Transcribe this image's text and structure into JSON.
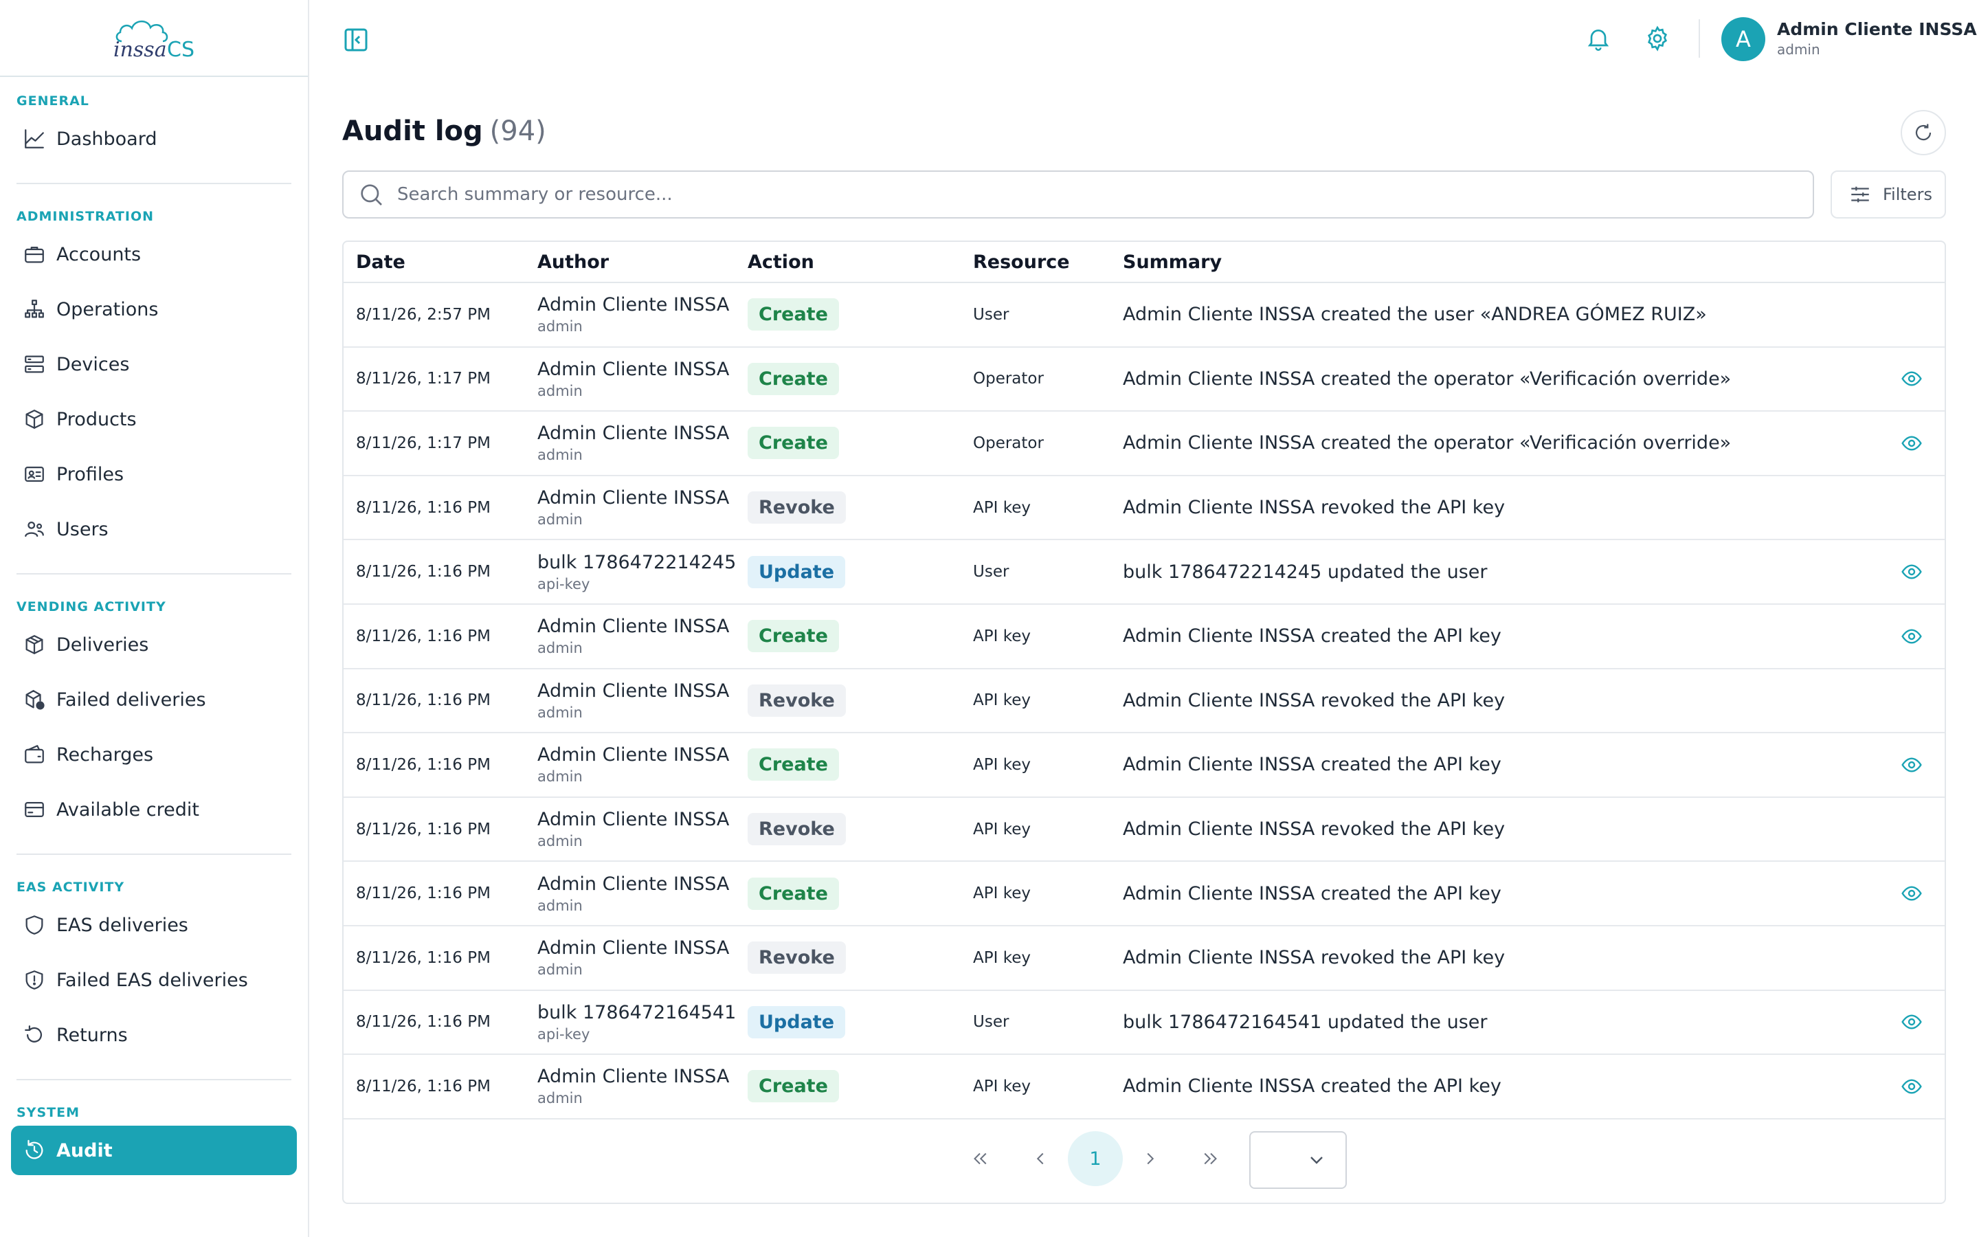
{
  "brand": {
    "name": "Inssa CS",
    "logo_text_left": "inssa",
    "logo_text_right": "CS",
    "accent": "#1ba3b4"
  },
  "sidebar": {
    "sections": [
      {
        "label": "GENERAL",
        "items": [
          {
            "label": "Dashboard",
            "icon": "chart-line-icon"
          }
        ]
      },
      {
        "label": "ADMINISTRATION",
        "items": [
          {
            "label": "Accounts",
            "icon": "briefcase-icon"
          },
          {
            "label": "Operations",
            "icon": "sitemap-icon"
          },
          {
            "label": "Devices",
            "icon": "server-icon"
          },
          {
            "label": "Products",
            "icon": "box-icon"
          },
          {
            "label": "Profiles",
            "icon": "id-card-icon"
          },
          {
            "label": "Users",
            "icon": "users-icon"
          }
        ]
      },
      {
        "label": "VENDING ACTIVITY",
        "items": [
          {
            "label": "Deliveries",
            "icon": "package-icon"
          },
          {
            "label": "Failed deliveries",
            "icon": "package-alert-icon"
          },
          {
            "label": "Recharges",
            "icon": "wallet-icon"
          },
          {
            "label": "Available credit",
            "icon": "credit-card-icon"
          }
        ]
      },
      {
        "label": "EAS ACTIVITY",
        "items": [
          {
            "label": "EAS deliveries",
            "icon": "shield-icon"
          },
          {
            "label": "Failed EAS deliveries",
            "icon": "shield-alert-icon"
          },
          {
            "label": "Returns",
            "icon": "return-icon"
          }
        ]
      },
      {
        "label": "SYSTEM",
        "items": [
          {
            "label": "Audit",
            "icon": "history-icon",
            "active": true
          }
        ]
      }
    ]
  },
  "topbar": {
    "user": {
      "initial": "A",
      "name": "Admin Cliente INSSA",
      "role": "admin"
    }
  },
  "main": {
    "title": "Audit log",
    "count": "(94)",
    "search_placeholder": "Search summary or resource...",
    "filters_label": "Filters",
    "columns": {
      "date": "Date",
      "author": "Author",
      "action": "Action",
      "resource": "Resource",
      "summary": "Summary"
    },
    "rows": [
      {
        "date": "8/11/26, 2:57 PM",
        "author": "Admin Cliente INSSA",
        "role": "admin",
        "action": "Create",
        "resource": "User",
        "summary": "Admin Cliente INSSA created the user «ANDREA GÓMEZ RUIZ»",
        "view": false
      },
      {
        "date": "8/11/26, 1:17 PM",
        "author": "Admin Cliente INSSA",
        "role": "admin",
        "action": "Create",
        "resource": "Operator",
        "summary": "Admin Cliente INSSA created the operator «Verificación override»",
        "view": true
      },
      {
        "date": "8/11/26, 1:17 PM",
        "author": "Admin Cliente INSSA",
        "role": "admin",
        "action": "Create",
        "resource": "Operator",
        "summary": "Admin Cliente INSSA created the operator «Verificación override»",
        "view": true
      },
      {
        "date": "8/11/26, 1:16 PM",
        "author": "Admin Cliente INSSA",
        "role": "admin",
        "action": "Revoke",
        "resource": "API key",
        "summary": "Admin Cliente INSSA revoked the API key",
        "view": false
      },
      {
        "date": "8/11/26, 1:16 PM",
        "author": "bulk 1786472214245",
        "role": "api-key",
        "action": "Update",
        "resource": "User",
        "summary": "bulk 1786472214245 updated the user",
        "view": true
      },
      {
        "date": "8/11/26, 1:16 PM",
        "author": "Admin Cliente INSSA",
        "role": "admin",
        "action": "Create",
        "resource": "API key",
        "summary": "Admin Cliente INSSA created the API key",
        "view": true
      },
      {
        "date": "8/11/26, 1:16 PM",
        "author": "Admin Cliente INSSA",
        "role": "admin",
        "action": "Revoke",
        "resource": "API key",
        "summary": "Admin Cliente INSSA revoked the API key",
        "view": false
      },
      {
        "date": "8/11/26, 1:16 PM",
        "author": "Admin Cliente INSSA",
        "role": "admin",
        "action": "Create",
        "resource": "API key",
        "summary": "Admin Cliente INSSA created the API key",
        "view": true
      },
      {
        "date": "8/11/26, 1:16 PM",
        "author": "Admin Cliente INSSA",
        "role": "admin",
        "action": "Revoke",
        "resource": "API key",
        "summary": "Admin Cliente INSSA revoked the API key",
        "view": false
      },
      {
        "date": "8/11/26, 1:16 PM",
        "author": "Admin Cliente INSSA",
        "role": "admin",
        "action": "Create",
        "resource": "API key",
        "summary": "Admin Cliente INSSA created the API key",
        "view": true
      },
      {
        "date": "8/11/26, 1:16 PM",
        "author": "Admin Cliente INSSA",
        "role": "admin",
        "action": "Revoke",
        "resource": "API key",
        "summary": "Admin Cliente INSSA revoked the API key",
        "view": false
      },
      {
        "date": "8/11/26, 1:16 PM",
        "author": "bulk 1786472164541",
        "role": "api-key",
        "action": "Update",
        "resource": "User",
        "summary": "bulk 1786472164541 updated the user",
        "view": true
      },
      {
        "date": "8/11/26, 1:16 PM",
        "author": "Admin Cliente INSSA",
        "role": "admin",
        "action": "Create",
        "resource": "API key",
        "summary": "Admin Cliente INSSA created the API key",
        "view": true
      }
    ],
    "pagination": {
      "current_page": "1",
      "page_size": ""
    }
  },
  "colors": {
    "accent": "#1ba3b4",
    "create_bg": "#e5f6ec",
    "create_fg": "#1e8449",
    "revoke_bg": "#f0f2f5",
    "revoke_fg": "#4b5563",
    "update_bg": "#e2f2fa",
    "update_fg": "#1b6fa3"
  }
}
